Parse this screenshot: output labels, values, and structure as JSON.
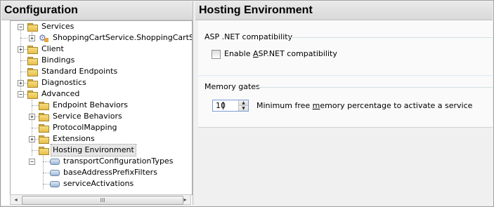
{
  "left_pane": {
    "title": "Configuration",
    "tree": [
      {
        "label": "Services",
        "expander": "−"
      },
      {
        "label": "ShoppingCartService.ShoppingCartServi",
        "expander": "+"
      },
      {
        "label": "Client",
        "expander": "+"
      },
      {
        "label": "Bindings",
        "expander": ""
      },
      {
        "label": "Standard Endpoints",
        "expander": ""
      },
      {
        "label": "Diagnostics",
        "expander": "+"
      },
      {
        "label": "Advanced",
        "expander": "−"
      },
      {
        "label": "Endpoint Behaviors",
        "expander": ""
      },
      {
        "label": "Service Behaviors",
        "expander": "+"
      },
      {
        "label": "ProtocolMapping",
        "expander": ""
      },
      {
        "label": "Extensions",
        "expander": "+"
      },
      {
        "label": "Hosting Environment",
        "expander": "−"
      },
      {
        "label": "transportConfigurationTypes",
        "expander": ""
      },
      {
        "label": "baseAddressPrefixFilters",
        "expander": ""
      },
      {
        "label": "serviceActivations",
        "expander": ""
      }
    ],
    "scrollbar": {
      "left_arrow": "◂",
      "right_arrow": "▸",
      "thumb_grip": "III"
    }
  },
  "right_pane": {
    "title": "Hosting Environment",
    "aspnet_group": {
      "title": "ASP .NET compatibility",
      "checkbox_label_pre": "Enable ",
      "checkbox_label_underlined": "A",
      "checkbox_label_post": "SP.NET compatibility",
      "checked": false
    },
    "memory_group": {
      "title": "Memory gates",
      "value": "10",
      "up": "▲",
      "down": "▼",
      "desc_pre": "Minimum free ",
      "desc_underlined": "m",
      "desc_post": "emory percentage to activate a service"
    }
  }
}
